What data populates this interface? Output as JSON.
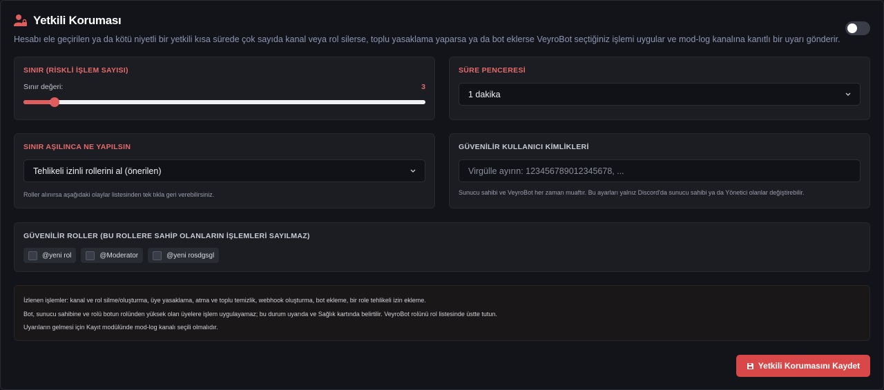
{
  "header": {
    "title": "Yetkili Koruması",
    "description": "Hesabı ele geçirilen ya da kötü niyetli bir yetkili kısa sürede çok sayıda kanal veya rol silerse, toplu yasaklama yaparsa ya da bot eklerse VeyroBot seçtiğiniz işlemi uygular ve mod-log kanalına kanıtlı bir uyarı gönderir.",
    "icon": "user-lock-icon",
    "toggle_enabled": false
  },
  "limit": {
    "label": "SINIR (RİSKLİ İŞLEM SAYISI)",
    "sub_label": "Sınır değeri:",
    "value": "3",
    "slider_fraction": 0.065
  },
  "window": {
    "label": "SÜRE PENCERESİ",
    "selected": "1 dakika"
  },
  "action": {
    "label": "SINIR AŞILINCA NE YAPILSIN",
    "selected": "Tehlikeli izinli rollerini al (önerilen)",
    "hint": "Roller alınırsa aşağıdaki olaylar listesinden tek tıkla geri verebilirsiniz."
  },
  "trusted_users": {
    "label": "GÜVENİLİR KULLANICI KİMLİKLERİ",
    "placeholder": "Virgülle ayırın: 123456789012345678, ...",
    "hint": "Sunucu sahibi ve VeyroBot her zaman muaftır. Bu ayarları yalnız Discord'da sunucu sahibi ya da Yönetici olanlar değiştirebilir."
  },
  "trusted_roles": {
    "label": "GÜVENİLİR ROLLER (BU ROLLERE SAHİP OLANLARIN İŞLEMLERİ SAYILMAZ)",
    "roles": [
      {
        "name": "@yeni rol",
        "checked": false
      },
      {
        "name": "@Moderator",
        "checked": false
      },
      {
        "name": "@yeni rosdgsgl",
        "checked": false
      }
    ]
  },
  "info": {
    "lines": [
      "İzlenen işlemler: kanal ve rol silme/oluşturma, üye yasaklama, atma ve toplu temizlik, webhook oluşturma, bot ekleme, bir role tehlikeli izin ekleme.",
      "Bot, sunucu sahibine ve rolü botun rolünden yüksek olan üyelere işlem uygulayamaz; bu durum uyarıda ve Sağlık kartında belirtilir. VeyroBot rolünü rol listesinde üstte tutun.",
      "Uyarıların gelmesi için Kayıt modülünde mod-log kanalı seçili olmalıdır."
    ]
  },
  "save_button": {
    "label": "Yetkili Korumasını Kaydet",
    "icon": "floppy-disk-icon"
  },
  "colors": {
    "accent": "#d84848",
    "background": "#131419",
    "card": "#1c1d23"
  }
}
